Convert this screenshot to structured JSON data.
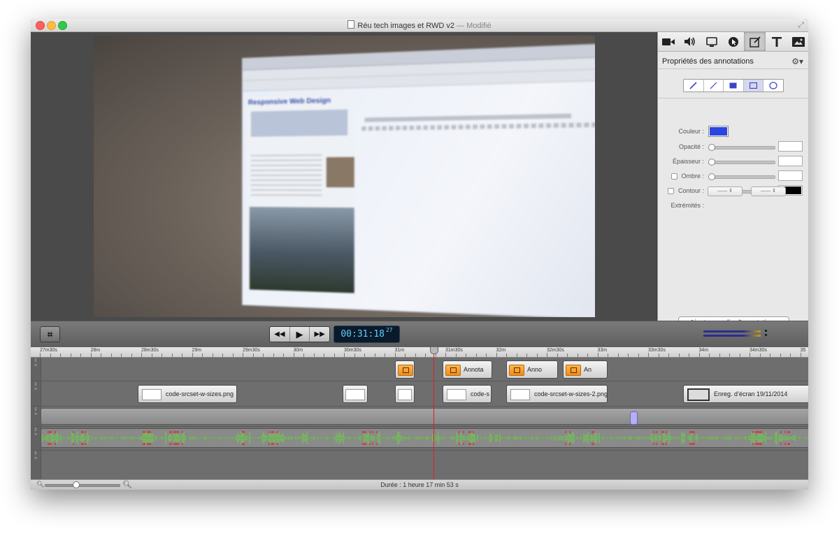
{
  "window": {
    "title": "Réu tech images et RWD v2",
    "title_suffix": "— Modifié"
  },
  "canvas": {
    "slide": {
      "heading": "Responsive Web Design"
    }
  },
  "inspector": {
    "tabs": [
      {
        "name": "video-tab",
        "icon": "video-camera-icon"
      },
      {
        "name": "audio-tab",
        "icon": "speaker-icon"
      },
      {
        "name": "screen-tab",
        "icon": "monitor-icon"
      },
      {
        "name": "cursor-tab",
        "icon": "cursor-icon"
      },
      {
        "name": "annotations-tab",
        "icon": "annotation-icon",
        "active": true
      },
      {
        "name": "text-tab",
        "icon": "text-icon"
      },
      {
        "name": "media-tab",
        "icon": "media-icon"
      }
    ],
    "title": "Propriétés des annotations",
    "shape_tools": [
      "freehand",
      "line",
      "filled-rect",
      "rect",
      "ellipse"
    ],
    "active_tool": "rect",
    "color_label": "Couleur :",
    "color_value": "#2b45e0",
    "opacity_label": "Opacité :",
    "thickness_label": "Épaisseur :",
    "shadow_label": "Ombre :",
    "outline_label": "Contour :",
    "outline_color": "#000000",
    "ends_label": "Extrémités :",
    "add_clip_label": "Ajouter un clip d’annotations"
  },
  "transport": {
    "timecode": "00:31:18",
    "frames": "27"
  },
  "ruler": {
    "labels": [
      "27m30s",
      "28m",
      "28m30s",
      "29m",
      "29m30s",
      "30m",
      "30m30s",
      "31m",
      "31m30s",
      "32m",
      "32m30s",
      "33m",
      "33m30s",
      "34m",
      "34m30s",
      "35"
    ]
  },
  "tracks": {
    "annotation_clips": [
      {
        "label": ""
      },
      {
        "label": "Annota"
      },
      {
        "label": "Anno"
      },
      {
        "label": "An"
      }
    ],
    "image_clips": [
      {
        "label": "code-srcset-w-sizes.png"
      },
      {
        "label": ""
      },
      {
        "label": ""
      },
      {
        "label": "code-s"
      },
      {
        "label": "code-srcset-w-sizes-2.png"
      },
      {
        "label": "Enreg. d’écran 19/11/2014"
      }
    ]
  },
  "status": {
    "duration": "Durée : 1 heure 17 min 53 s"
  }
}
